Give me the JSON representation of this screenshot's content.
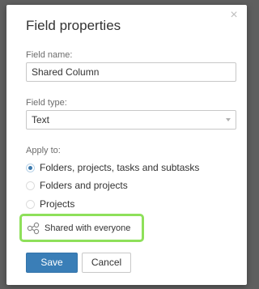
{
  "dialog": {
    "title": "Field properties",
    "close_icon": "×"
  },
  "field_name": {
    "label": "Field name:",
    "value": "Shared Column"
  },
  "field_type": {
    "label": "Field type:",
    "value": "Text"
  },
  "apply_to": {
    "label": "Apply to:",
    "options": [
      {
        "label": "Folders, projects, tasks and subtasks",
        "checked": true
      },
      {
        "label": "Folders and projects",
        "checked": false
      },
      {
        "label": "Projects",
        "checked": false
      }
    ]
  },
  "sharing": {
    "label": "Shared with everyone",
    "icon": "share-icon",
    "highlight_color": "#8ee05a"
  },
  "buttons": {
    "save": "Save",
    "cancel": "Cancel"
  },
  "colors": {
    "primary": "#3a7eb7",
    "overlay": "#5f5f5f"
  }
}
